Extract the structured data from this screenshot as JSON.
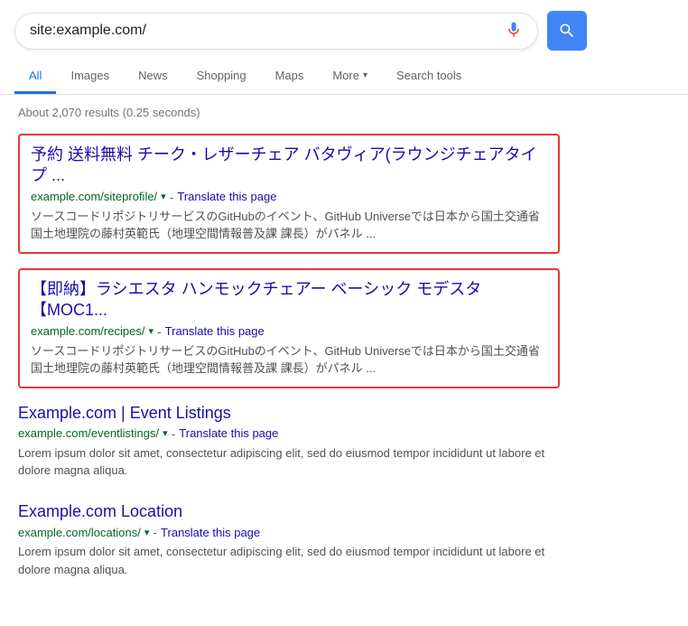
{
  "searchbar": {
    "query": "site:example.com/",
    "placeholder": "Search"
  },
  "nav": {
    "tabs": [
      {
        "id": "all",
        "label": "All",
        "active": true
      },
      {
        "id": "images",
        "label": "Images",
        "active": false
      },
      {
        "id": "news",
        "label": "News",
        "active": false
      },
      {
        "id": "shopping",
        "label": "Shopping",
        "active": false
      },
      {
        "id": "maps",
        "label": "Maps",
        "active": false
      },
      {
        "id": "more",
        "label": "More",
        "active": false,
        "hasChevron": true
      },
      {
        "id": "search-tools",
        "label": "Search tools",
        "active": false
      }
    ]
  },
  "results": {
    "stats": "About 2,070 results (0.25 seconds)",
    "items": [
      {
        "id": "result1",
        "highlighted": true,
        "title": "予約 送料無料 チーク・レザーチェア バタヴィア(ラウンジチェアタイプ ...",
        "url": "example.com/siteprofile/",
        "translate": "Translate this page",
        "snippet": "ソースコードリポジトリサービスのGitHubのイベント、GitHub Universeでは日本から国土交通省国土地理院の藤村英範氏（地理空間情報普及課 課長）がパネル ..."
      },
      {
        "id": "result2",
        "highlighted": true,
        "title": "【即納】ラシエスタ ハンモックチェアー ベーシック モデスタ 【MOC1...",
        "url": "example.com/recipes/",
        "translate": "Translate this page",
        "snippet": "ソースコードリポジトリサービスのGitHubのイベント、GitHub Universeでは日本から国土交通省国土地理院の藤村英範氏（地理空間情報普及課 課長）がパネル ..."
      },
      {
        "id": "result3",
        "highlighted": false,
        "title": "Example.com | Event Listings",
        "url": "example.com/eventlistings/",
        "translate": "Translate this page",
        "snippet": "Lorem ipsum dolor sit amet, consectetur adipiscing elit, sed do eiusmod tempor incididunt ut labore et dolore magna aliqua."
      },
      {
        "id": "result4",
        "highlighted": false,
        "title": "Example.com Location",
        "url": "example.com/locations/",
        "translate": "Translate this page",
        "snippet": "Lorem ipsum dolor sit amet, consectetur adipiscing elit, sed do eiusmod tempor incididunt ut labore et dolore magna aliqua."
      }
    ]
  },
  "icons": {
    "mic": "🎤",
    "search": "🔍",
    "chevron_down": "▾"
  }
}
